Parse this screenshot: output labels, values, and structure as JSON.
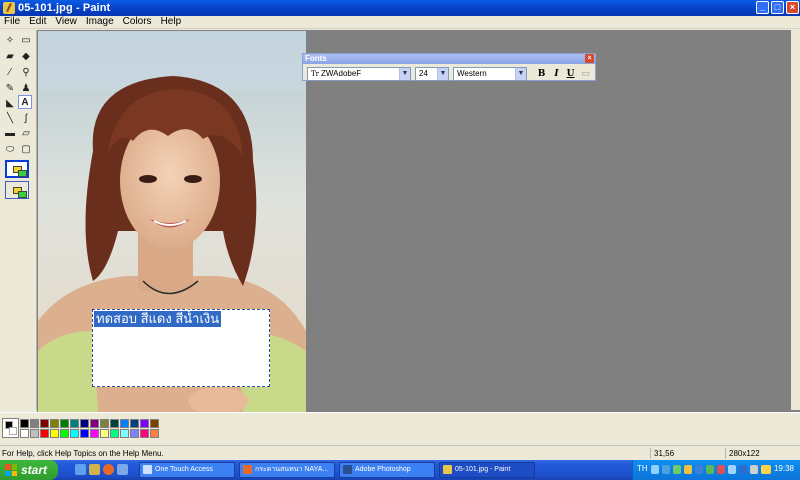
{
  "window": {
    "title": "05-101.jpg - Paint"
  },
  "menu": [
    "File",
    "Edit",
    "View",
    "Image",
    "Colors",
    "Help"
  ],
  "fonts_toolbar": {
    "title": "Fonts",
    "font_name": "ZWAdobeF",
    "font_size": "24",
    "script": "Western",
    "bold": "B",
    "italic": "I",
    "underline": "U"
  },
  "canvas": {
    "typed_text": "ทดสอบ สีแดง สีน้ำเงิน"
  },
  "palette": {
    "row1": [
      "#000000",
      "#808080",
      "#800000",
      "#808000",
      "#008000",
      "#008080",
      "#000080",
      "#800080",
      "#808040",
      "#004040",
      "#0080ff",
      "#004080",
      "#8000ff",
      "#804000"
    ],
    "row2": [
      "#ffffff",
      "#c0c0c0",
      "#ff0000",
      "#ffff00",
      "#00ff00",
      "#00ffff",
      "#0000ff",
      "#ff00ff",
      "#ffff80",
      "#00ff80",
      "#80ffff",
      "#8080ff",
      "#ff0080",
      "#ff8040"
    ]
  },
  "status": {
    "help": "For Help, click Help Topics on the Help Menu.",
    "coords": "31,56",
    "size": "280x122"
  },
  "taskbar": {
    "start": "start",
    "tasks": [
      "One Touch Access",
      "กระดานสนทนา NAYA...",
      "Adobe Photoshop",
      "05-101.jpg - Paint"
    ],
    "language": "TH",
    "time": "19:38"
  },
  "colors": {
    "accent": "#0a5be6",
    "selection": "#316ac5"
  }
}
